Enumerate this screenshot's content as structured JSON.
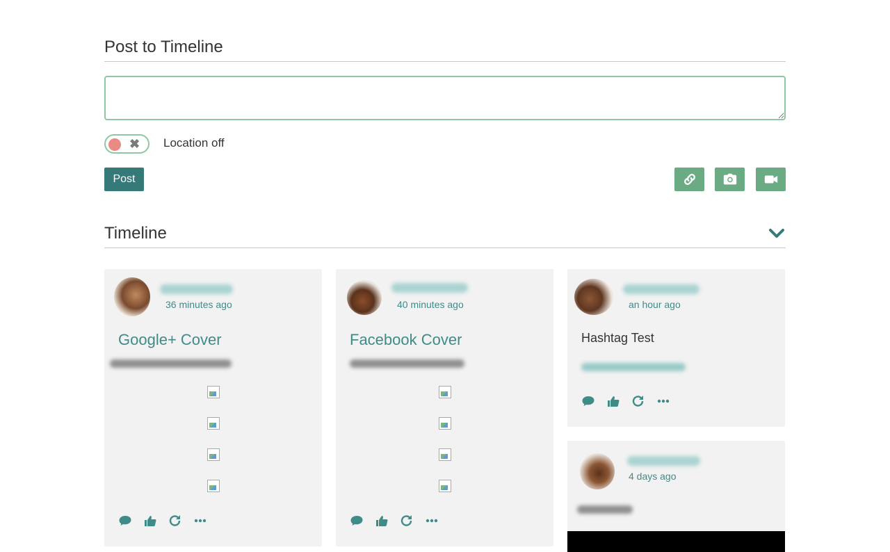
{
  "compose": {
    "title": "Post to Timeline",
    "placeholder": "",
    "location_label": "Location off",
    "toggle_symbol": "✖",
    "post_label": "Post",
    "media_buttons": [
      "link-icon",
      "camera-icon",
      "video-icon"
    ]
  },
  "timeline": {
    "title": "Timeline",
    "cards": [
      {
        "time": "36 minutes ago",
        "title": "Google+ Cover"
      },
      {
        "time": "40 minutes ago",
        "title": "Facebook Cover"
      },
      {
        "time": "an hour ago",
        "text": "Hashtag Test"
      },
      {
        "time": "4 days ago"
      }
    ]
  },
  "colors": {
    "accent": "#357a78",
    "link": "#3f8b88",
    "media_button": "#6aab84",
    "toggle_border": "#8fc6a3",
    "toggle_knob": "#e98a83",
    "card_bg": "#f2f2f2"
  }
}
